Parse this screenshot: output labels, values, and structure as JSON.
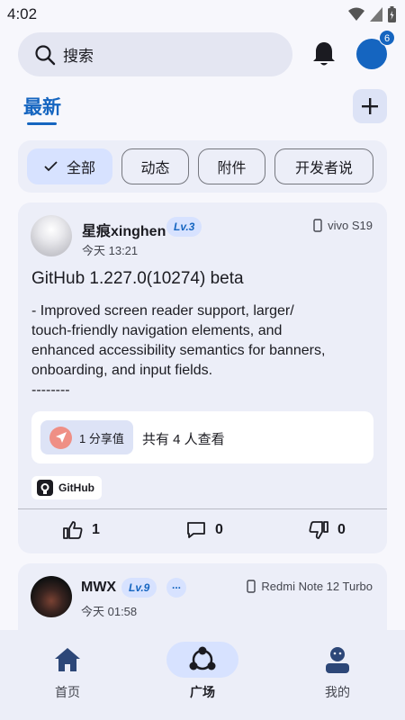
{
  "status_bar": {
    "time": "4:02"
  },
  "header": {
    "search_placeholder": "搜索",
    "notification_count": "6"
  },
  "tabs": {
    "active": "最新"
  },
  "filters": [
    {
      "label": "全部",
      "selected": true
    },
    {
      "label": "动态",
      "selected": false
    },
    {
      "label": "附件",
      "selected": false
    },
    {
      "label": "开发者说",
      "selected": false
    }
  ],
  "post": {
    "username": "星痕xinghen",
    "level": "Lv.3",
    "time": "今天 13:21",
    "device": "vivo S19",
    "title": "GitHub 1.227.0(10274) beta",
    "body": "- Improved screen reader support, larger/\ntouch-friendly navigation elements, and\nenhanced accessibility semantics for banners,\nonboarding, and input fields.\n--------",
    "share_label": "1 分享值",
    "viewers": "共有 4 人查看",
    "tag": "GitHub",
    "likes": "1",
    "comments": "0",
    "dislikes": "0"
  },
  "post2": {
    "username": "MWX",
    "level": "Lv.9",
    "extra_badge": "...",
    "time": "今天 01:58",
    "device": "Redmi Note 12 Turbo"
  },
  "bottom_nav": [
    {
      "label": "首页",
      "icon": "home-icon",
      "active": false
    },
    {
      "label": "广场",
      "icon": "community-icon",
      "active": true
    },
    {
      "label": "我的",
      "icon": "profile-icon",
      "active": false
    }
  ],
  "colors": {
    "accent": "#1565c0",
    "surface": "#eceef8",
    "chip_selected": "#d7e2ff"
  }
}
